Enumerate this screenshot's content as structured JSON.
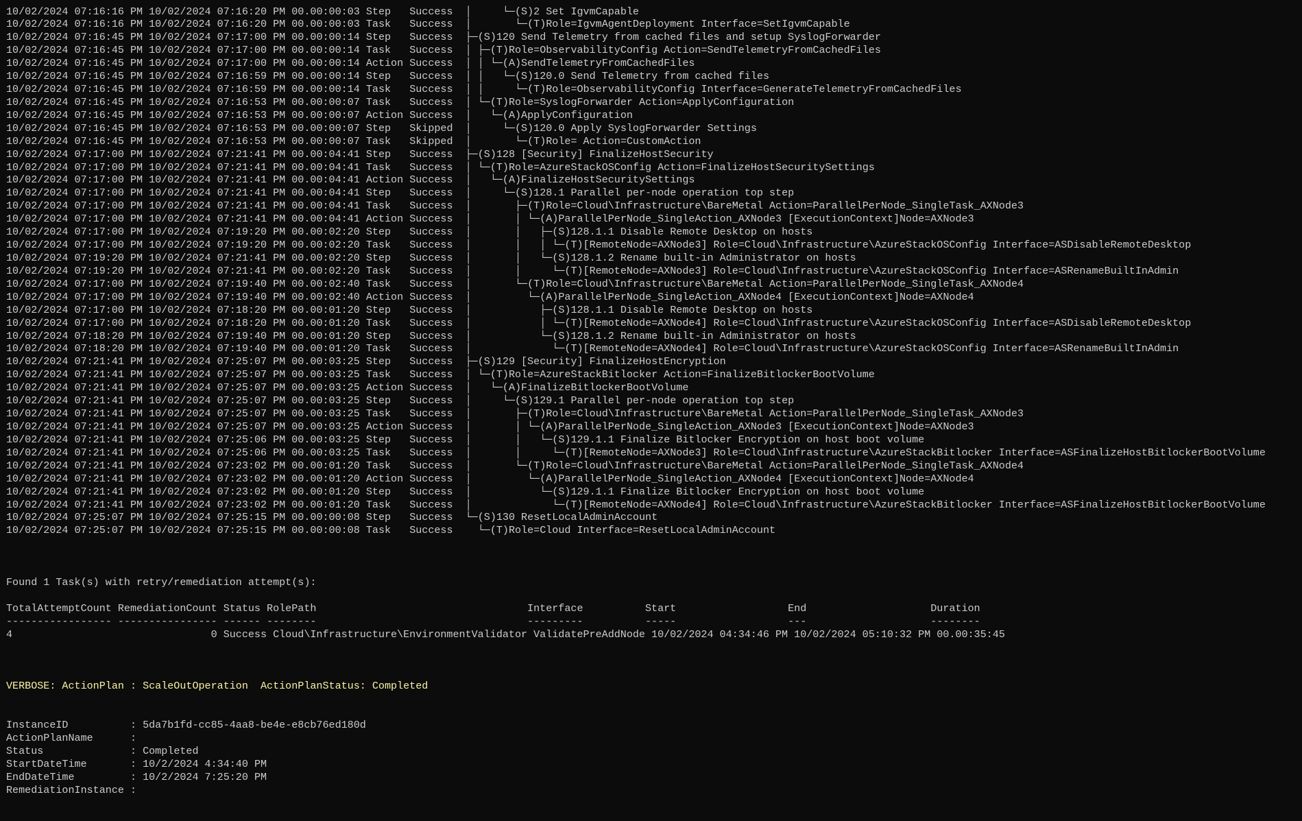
{
  "colors": {
    "background": "#0c0c0c",
    "text": "#cccccc",
    "verbose": "#f9f1a5"
  },
  "log_rows": [
    {
      "start": "10/02/2024 07:16:16 PM",
      "end": "10/02/2024 07:16:20 PM",
      "duration": "00.00:00:03",
      "type": "Step",
      "status": "Success",
      "tree": "│     └─(S)2 Set IgvmCapable"
    },
    {
      "start": "10/02/2024 07:16:16 PM",
      "end": "10/02/2024 07:16:20 PM",
      "duration": "00.00:00:03",
      "type": "Task",
      "status": "Success",
      "tree": "│       └─(T)Role=IgvmAgentDeployment Interface=SetIgvmCapable"
    },
    {
      "start": "10/02/2024 07:16:45 PM",
      "end": "10/02/2024 07:17:00 PM",
      "duration": "00.00:00:14",
      "type": "Step",
      "status": "Success",
      "tree": "├─(S)120 Send Telemetry from cached files and setup SyslogForwarder"
    },
    {
      "start": "10/02/2024 07:16:45 PM",
      "end": "10/02/2024 07:17:00 PM",
      "duration": "00.00:00:14",
      "type": "Task",
      "status": "Success",
      "tree": "│ ├─(T)Role=ObservabilityConfig Action=SendTelemetryFromCachedFiles"
    },
    {
      "start": "10/02/2024 07:16:45 PM",
      "end": "10/02/2024 07:17:00 PM",
      "duration": "00.00:00:14",
      "type": "Action",
      "status": "Success",
      "tree": "│ │ └─(A)SendTelemetryFromCachedFiles"
    },
    {
      "start": "10/02/2024 07:16:45 PM",
      "end": "10/02/2024 07:16:59 PM",
      "duration": "00.00:00:14",
      "type": "Step",
      "status": "Success",
      "tree": "│ │   └─(S)120.0 Send Telemetry from cached files"
    },
    {
      "start": "10/02/2024 07:16:45 PM",
      "end": "10/02/2024 07:16:59 PM",
      "duration": "00.00:00:14",
      "type": "Task",
      "status": "Success",
      "tree": "│ │     └─(T)Role=ObservabilityConfig Interface=GenerateTelemetryFromCachedFiles"
    },
    {
      "start": "10/02/2024 07:16:45 PM",
      "end": "10/02/2024 07:16:53 PM",
      "duration": "00.00:00:07",
      "type": "Task",
      "status": "Success",
      "tree": "│ └─(T)Role=SyslogForwarder Action=ApplyConfiguration"
    },
    {
      "start": "10/02/2024 07:16:45 PM",
      "end": "10/02/2024 07:16:53 PM",
      "duration": "00.00:00:07",
      "type": "Action",
      "status": "Success",
      "tree": "│   └─(A)ApplyConfiguration"
    },
    {
      "start": "10/02/2024 07:16:45 PM",
      "end": "10/02/2024 07:16:53 PM",
      "duration": "00.00:00:07",
      "type": "Step",
      "status": "Skipped",
      "tree": "│     └─(S)120.0 Apply SyslogForwarder Settings"
    },
    {
      "start": "10/02/2024 07:16:45 PM",
      "end": "10/02/2024 07:16:53 PM",
      "duration": "00.00:00:07",
      "type": "Task",
      "status": "Skipped",
      "tree": "│       └─(T)Role= Action=CustomAction"
    },
    {
      "start": "10/02/2024 07:17:00 PM",
      "end": "10/02/2024 07:21:41 PM",
      "duration": "00.00:04:41",
      "type": "Step",
      "status": "Success",
      "tree": "├─(S)128 [Security] FinalizeHostSecurity"
    },
    {
      "start": "10/02/2024 07:17:00 PM",
      "end": "10/02/2024 07:21:41 PM",
      "duration": "00.00:04:41",
      "type": "Task",
      "status": "Success",
      "tree": "│ └─(T)Role=AzureStackOSConfig Action=FinalizeHostSecuritySettings"
    },
    {
      "start": "10/02/2024 07:17:00 PM",
      "end": "10/02/2024 07:21:41 PM",
      "duration": "00.00:04:41",
      "type": "Action",
      "status": "Success",
      "tree": "│   └─(A)FinalizeHostSecuritySettings"
    },
    {
      "start": "10/02/2024 07:17:00 PM",
      "end": "10/02/2024 07:21:41 PM",
      "duration": "00.00:04:41",
      "type": "Step",
      "status": "Success",
      "tree": "│     └─(S)128.1 Parallel per-node operation top step"
    },
    {
      "start": "10/02/2024 07:17:00 PM",
      "end": "10/02/2024 07:21:41 PM",
      "duration": "00.00:04:41",
      "type": "Task",
      "status": "Success",
      "tree": "│       ├─(T)Role=Cloud\\Infrastructure\\BareMetal Action=ParallelPerNode_SingleTask_AXNode3"
    },
    {
      "start": "10/02/2024 07:17:00 PM",
      "end": "10/02/2024 07:21:41 PM",
      "duration": "00.00:04:41",
      "type": "Action",
      "status": "Success",
      "tree": "│       │ └─(A)ParallelPerNode_SingleAction_AXNode3 [ExecutionContext]Node=AXNode3"
    },
    {
      "start": "10/02/2024 07:17:00 PM",
      "end": "10/02/2024 07:19:20 PM",
      "duration": "00.00:02:20",
      "type": "Step",
      "status": "Success",
      "tree": "│       │   ├─(S)128.1.1 Disable Remote Desktop on hosts"
    },
    {
      "start": "10/02/2024 07:17:00 PM",
      "end": "10/02/2024 07:19:20 PM",
      "duration": "00.00:02:20",
      "type": "Task",
      "status": "Success",
      "tree": "│       │   │ └─(T)[RemoteNode=AXNode3] Role=Cloud\\Infrastructure\\AzureStackOSConfig Interface=ASDisableRemoteDesktop"
    },
    {
      "start": "10/02/2024 07:19:20 PM",
      "end": "10/02/2024 07:21:41 PM",
      "duration": "00.00:02:20",
      "type": "Step",
      "status": "Success",
      "tree": "│       │   └─(S)128.1.2 Rename built-in Administrator on hosts"
    },
    {
      "start": "10/02/2024 07:19:20 PM",
      "end": "10/02/2024 07:21:41 PM",
      "duration": "00.00:02:20",
      "type": "Task",
      "status": "Success",
      "tree": "│       │     └─(T)[RemoteNode=AXNode3] Role=Cloud\\Infrastructure\\AzureStackOSConfig Interface=ASRenameBuiltInAdmin"
    },
    {
      "start": "10/02/2024 07:17:00 PM",
      "end": "10/02/2024 07:19:40 PM",
      "duration": "00.00:02:40",
      "type": "Task",
      "status": "Success",
      "tree": "│       └─(T)Role=Cloud\\Infrastructure\\BareMetal Action=ParallelPerNode_SingleTask_AXNode4"
    },
    {
      "start": "10/02/2024 07:17:00 PM",
      "end": "10/02/2024 07:19:40 PM",
      "duration": "00.00:02:40",
      "type": "Action",
      "status": "Success",
      "tree": "│         └─(A)ParallelPerNode_SingleAction_AXNode4 [ExecutionContext]Node=AXNode4"
    },
    {
      "start": "10/02/2024 07:17:00 PM",
      "end": "10/02/2024 07:18:20 PM",
      "duration": "00.00:01:20",
      "type": "Step",
      "status": "Success",
      "tree": "│           ├─(S)128.1.1 Disable Remote Desktop on hosts"
    },
    {
      "start": "10/02/2024 07:17:00 PM",
      "end": "10/02/2024 07:18:20 PM",
      "duration": "00.00:01:20",
      "type": "Task",
      "status": "Success",
      "tree": "│           │ └─(T)[RemoteNode=AXNode4] Role=Cloud\\Infrastructure\\AzureStackOSConfig Interface=ASDisableRemoteDesktop"
    },
    {
      "start": "10/02/2024 07:18:20 PM",
      "end": "10/02/2024 07:19:40 PM",
      "duration": "00.00:01:20",
      "type": "Step",
      "status": "Success",
      "tree": "│           └─(S)128.1.2 Rename built-in Administrator on hosts"
    },
    {
      "start": "10/02/2024 07:18:20 PM",
      "end": "10/02/2024 07:19:40 PM",
      "duration": "00.00:01:20",
      "type": "Task",
      "status": "Success",
      "tree": "│             └─(T)[RemoteNode=AXNode4] Role=Cloud\\Infrastructure\\AzureStackOSConfig Interface=ASRenameBuiltInAdmin"
    },
    {
      "start": "10/02/2024 07:21:41 PM",
      "end": "10/02/2024 07:25:07 PM",
      "duration": "00.00:03:25",
      "type": "Step",
      "status": "Success",
      "tree": "├─(S)129 [Security] FinalizeHostEncryption"
    },
    {
      "start": "10/02/2024 07:21:41 PM",
      "end": "10/02/2024 07:25:07 PM",
      "duration": "00.00:03:25",
      "type": "Task",
      "status": "Success",
      "tree": "│ └─(T)Role=AzureStackBitlocker Action=FinalizeBitlockerBootVolume"
    },
    {
      "start": "10/02/2024 07:21:41 PM",
      "end": "10/02/2024 07:25:07 PM",
      "duration": "00.00:03:25",
      "type": "Action",
      "status": "Success",
      "tree": "│   └─(A)FinalizeBitlockerBootVolume"
    },
    {
      "start": "10/02/2024 07:21:41 PM",
      "end": "10/02/2024 07:25:07 PM",
      "duration": "00.00:03:25",
      "type": "Step",
      "status": "Success",
      "tree": "│     └─(S)129.1 Parallel per-node operation top step"
    },
    {
      "start": "10/02/2024 07:21:41 PM",
      "end": "10/02/2024 07:25:07 PM",
      "duration": "00.00:03:25",
      "type": "Task",
      "status": "Success",
      "tree": "│       ├─(T)Role=Cloud\\Infrastructure\\BareMetal Action=ParallelPerNode_SingleTask_AXNode3"
    },
    {
      "start": "10/02/2024 07:21:41 PM",
      "end": "10/02/2024 07:25:07 PM",
      "duration": "00.00:03:25",
      "type": "Action",
      "status": "Success",
      "tree": "│       │ └─(A)ParallelPerNode_SingleAction_AXNode3 [ExecutionContext]Node=AXNode3"
    },
    {
      "start": "10/02/2024 07:21:41 PM",
      "end": "10/02/2024 07:25:06 PM",
      "duration": "00.00:03:25",
      "type": "Step",
      "status": "Success",
      "tree": "│       │   └─(S)129.1.1 Finalize Bitlocker Encryption on host boot volume"
    },
    {
      "start": "10/02/2024 07:21:41 PM",
      "end": "10/02/2024 07:25:06 PM",
      "duration": "00.00:03:25",
      "type": "Task",
      "status": "Success",
      "tree": "│       │     └─(T)[RemoteNode=AXNode3] Role=Cloud\\Infrastructure\\AzureStackBitlocker Interface=ASFinalizeHostBitlockerBootVolume"
    },
    {
      "start": "10/02/2024 07:21:41 PM",
      "end": "10/02/2024 07:23:02 PM",
      "duration": "00.00:01:20",
      "type": "Task",
      "status": "Success",
      "tree": "│       └─(T)Role=Cloud\\Infrastructure\\BareMetal Action=ParallelPerNode_SingleTask_AXNode4"
    },
    {
      "start": "10/02/2024 07:21:41 PM",
      "end": "10/02/2024 07:23:02 PM",
      "duration": "00.00:01:20",
      "type": "Action",
      "status": "Success",
      "tree": "│         └─(A)ParallelPerNode_SingleAction_AXNode4 [ExecutionContext]Node=AXNode4"
    },
    {
      "start": "10/02/2024 07:21:41 PM",
      "end": "10/02/2024 07:23:02 PM",
      "duration": "00.00:01:20",
      "type": "Step",
      "status": "Success",
      "tree": "│           └─(S)129.1.1 Finalize Bitlocker Encryption on host boot volume"
    },
    {
      "start": "10/02/2024 07:21:41 PM",
      "end": "10/02/2024 07:23:02 PM",
      "duration": "00.00:01:20",
      "type": "Task",
      "status": "Success",
      "tree": "│             └─(T)[RemoteNode=AXNode4] Role=Cloud\\Infrastructure\\AzureStackBitlocker Interface=ASFinalizeHostBitlockerBootVolume"
    },
    {
      "start": "10/02/2024 07:25:07 PM",
      "end": "10/02/2024 07:25:15 PM",
      "duration": "00.00:00:08",
      "type": "Step",
      "status": "Success",
      "tree": "└─(S)130 ResetLocalAdminAccount"
    },
    {
      "start": "10/02/2024 07:25:07 PM",
      "end": "10/02/2024 07:25:15 PM",
      "duration": "00.00:00:08",
      "type": "Task",
      "status": "Success",
      "tree": "  └─(T)Role=Cloud Interface=ResetLocalAdminAccount"
    }
  ],
  "retry_summary": "Found 1 Task(s) with retry/remediation attempt(s):",
  "retry_table": {
    "headers": [
      "TotalAttemptCount",
      "RemediationCount",
      "Status",
      "RolePath",
      "Interface",
      "Start",
      "End",
      "Duration"
    ],
    "underlines": [
      "-----------------",
      "----------------",
      "------",
      "--------",
      "---------",
      "-----",
      "---",
      "--------"
    ],
    "rows": [
      [
        "4",
        "0",
        "Success",
        "Cloud\\Infrastructure\\EnvironmentValidator",
        "ValidatePreAddNode",
        "10/02/2024 04:34:46 PM",
        "10/02/2024 05:10:32 PM",
        "00.00:35:45"
      ]
    ]
  },
  "verbose_line": "VERBOSE: ActionPlan : ScaleOutOperation  ActionPlanStatus: Completed",
  "properties": [
    {
      "name": "InstanceID",
      "value": "5da7b1fd-cc85-4aa8-be4e-e8cb76ed180d"
    },
    {
      "name": "ActionPlanName",
      "value": ""
    },
    {
      "name": "Status",
      "value": "Completed"
    },
    {
      "name": "StartDateTime",
      "value": "10/2/2024 4:34:40 PM"
    },
    {
      "name": "EndDateTime",
      "value": "10/2/2024 7:25:20 PM"
    },
    {
      "name": "RemediationInstance",
      "value": ""
    }
  ]
}
